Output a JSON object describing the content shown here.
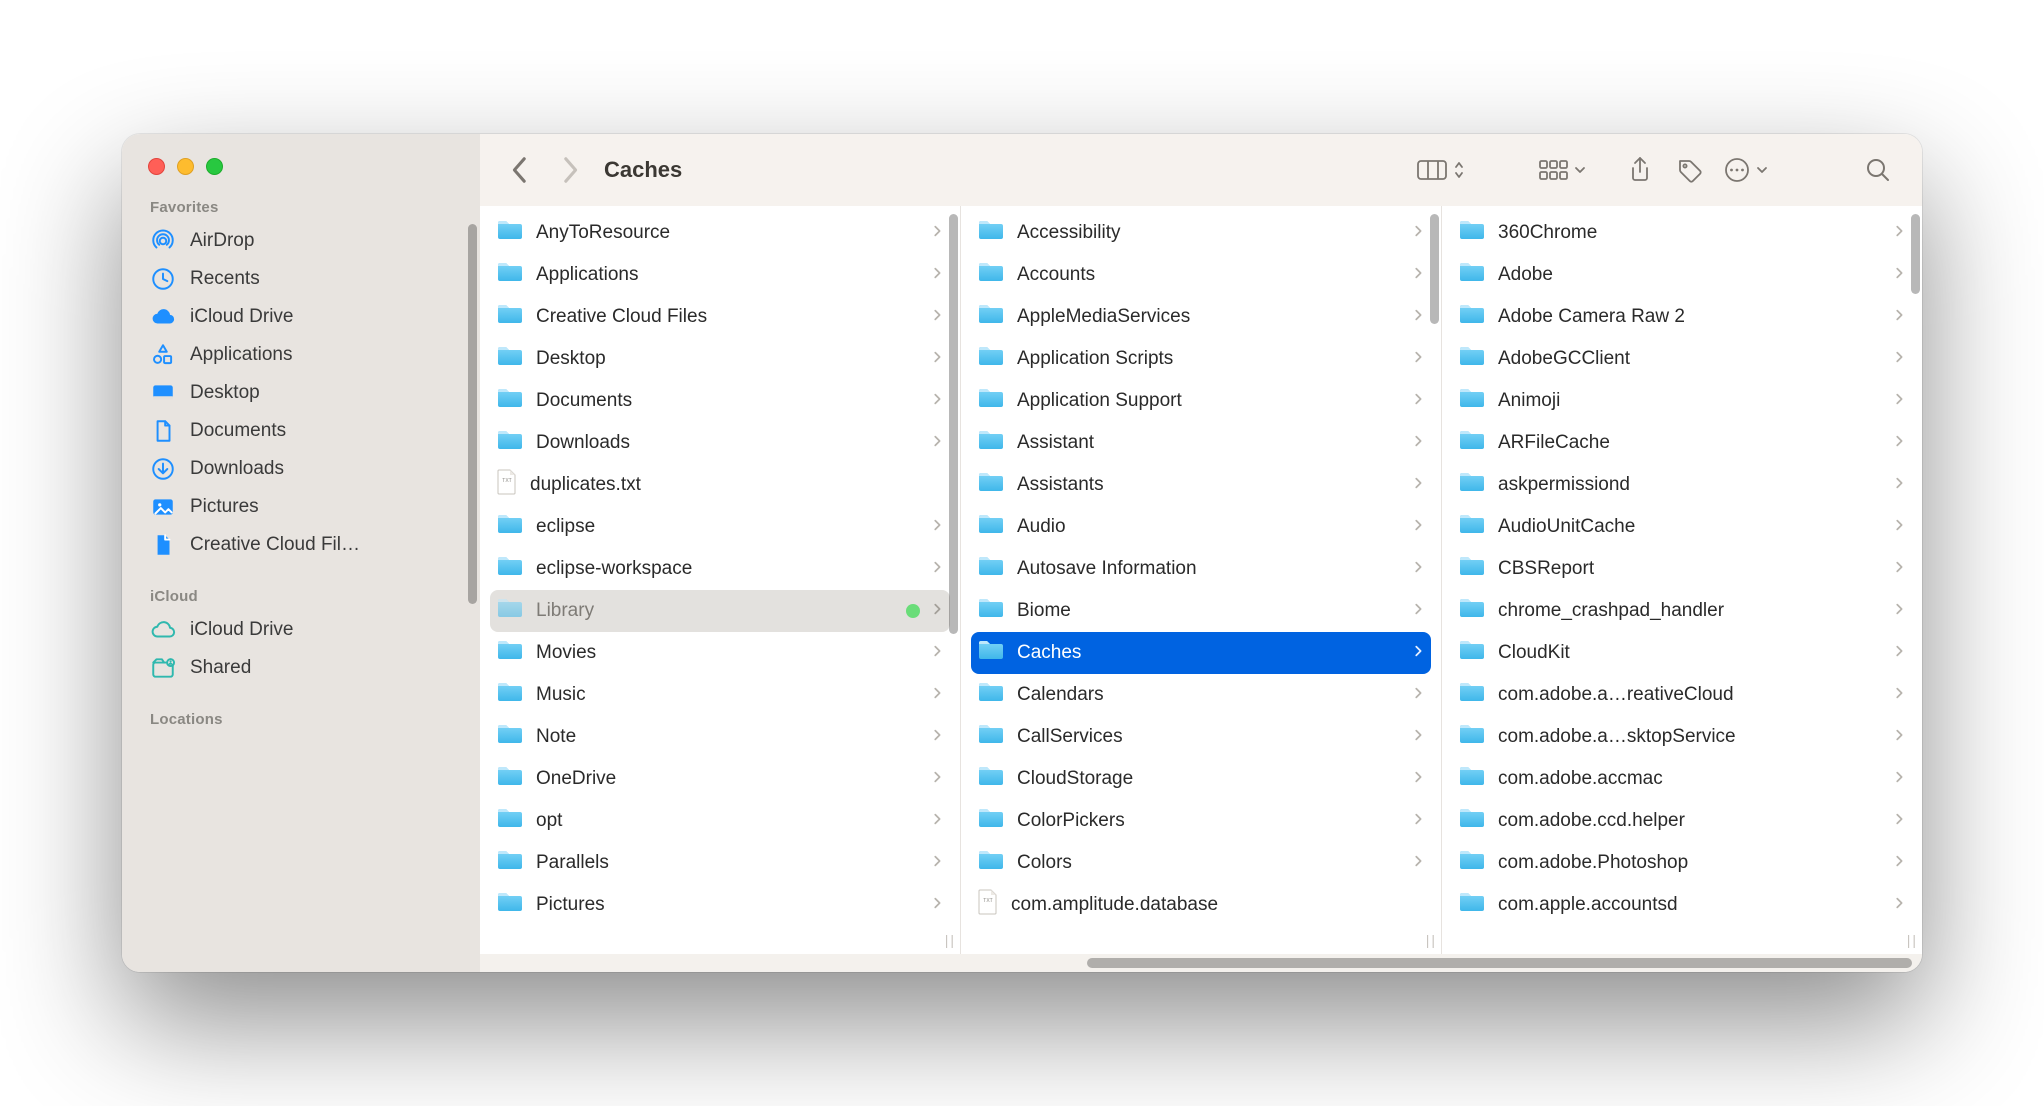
{
  "window_title": "Caches",
  "sidebar": {
    "sections": [
      {
        "heading": "Favorites",
        "items": [
          {
            "icon": "airdrop",
            "label": "AirDrop"
          },
          {
            "icon": "recents",
            "label": "Recents"
          },
          {
            "icon": "icloud",
            "label": "iCloud Drive"
          },
          {
            "icon": "apps",
            "label": "Applications"
          },
          {
            "icon": "desktop",
            "label": "Desktop"
          },
          {
            "icon": "doc",
            "label": "Documents"
          },
          {
            "icon": "downloads",
            "label": "Downloads"
          },
          {
            "icon": "pictures",
            "label": "Pictures"
          },
          {
            "icon": "ccfile",
            "label": "Creative Cloud Fil…"
          }
        ]
      },
      {
        "heading": "iCloud",
        "items": [
          {
            "icon": "icloud-outline",
            "label": "iCloud Drive"
          },
          {
            "icon": "shared",
            "label": "Shared"
          }
        ]
      },
      {
        "heading": "Locations",
        "items": []
      }
    ]
  },
  "columns": [
    {
      "scroll_thumb_height": 420,
      "items": [
        {
          "type": "folder",
          "name": "AnyToResource"
        },
        {
          "type": "folder",
          "name": "Applications"
        },
        {
          "type": "folder",
          "name": "Creative Cloud Files"
        },
        {
          "type": "folder",
          "name": "Desktop"
        },
        {
          "type": "folder",
          "name": "Documents"
        },
        {
          "type": "folder",
          "name": "Downloads"
        },
        {
          "type": "file",
          "name": "duplicates.txt"
        },
        {
          "type": "folder",
          "name": "eclipse"
        },
        {
          "type": "folder",
          "name": "eclipse-workspace"
        },
        {
          "type": "folder",
          "name": "Library",
          "selected": "bg",
          "tag": "#6add79"
        },
        {
          "type": "folder",
          "name": "Movies"
        },
        {
          "type": "folder",
          "name": "Music"
        },
        {
          "type": "folder",
          "name": "Note"
        },
        {
          "type": "folder",
          "name": "OneDrive"
        },
        {
          "type": "folder",
          "name": "opt"
        },
        {
          "type": "folder",
          "name": "Parallels"
        },
        {
          "type": "folder",
          "name": "Pictures"
        }
      ]
    },
    {
      "scroll_thumb_height": 110,
      "items": [
        {
          "type": "folder",
          "name": "Accessibility"
        },
        {
          "type": "folder",
          "name": "Accounts"
        },
        {
          "type": "folder",
          "name": "AppleMediaServices"
        },
        {
          "type": "folder",
          "name": "Application Scripts"
        },
        {
          "type": "folder",
          "name": "Application Support"
        },
        {
          "type": "folder",
          "name": "Assistant"
        },
        {
          "type": "folder",
          "name": "Assistants"
        },
        {
          "type": "folder",
          "name": "Audio"
        },
        {
          "type": "folder",
          "name": "Autosave Information"
        },
        {
          "type": "folder",
          "name": "Biome"
        },
        {
          "type": "folder",
          "name": "Caches",
          "selected": "hl"
        },
        {
          "type": "folder",
          "name": "Calendars"
        },
        {
          "type": "folder",
          "name": "CallServices"
        },
        {
          "type": "folder",
          "name": "CloudStorage"
        },
        {
          "type": "folder",
          "name": "ColorPickers"
        },
        {
          "type": "folder",
          "name": "Colors"
        },
        {
          "type": "file",
          "name": "com.amplitude.database",
          "no_chevron": true
        }
      ]
    },
    {
      "scroll_thumb_height": 80,
      "items": [
        {
          "type": "folder",
          "name": "360Chrome"
        },
        {
          "type": "folder",
          "name": "Adobe"
        },
        {
          "type": "folder",
          "name": "Adobe Camera Raw 2"
        },
        {
          "type": "folder",
          "name": "AdobeGCClient"
        },
        {
          "type": "folder",
          "name": "Animoji"
        },
        {
          "type": "folder",
          "name": "ARFileCache"
        },
        {
          "type": "folder",
          "name": "askpermissiond"
        },
        {
          "type": "folder",
          "name": "AudioUnitCache"
        },
        {
          "type": "folder",
          "name": "CBSReport"
        },
        {
          "type": "folder",
          "name": "chrome_crashpad_handler"
        },
        {
          "type": "folder",
          "name": "CloudKit"
        },
        {
          "type": "folder",
          "name": "com.adobe.a…reativeCloud"
        },
        {
          "type": "folder",
          "name": "com.adobe.a…sktopService"
        },
        {
          "type": "folder",
          "name": "com.adobe.accmac"
        },
        {
          "type": "folder",
          "name": "com.adobe.ccd.helper"
        },
        {
          "type": "folder",
          "name": "com.adobe.Photoshop"
        },
        {
          "type": "folder",
          "name": "com.apple.accountsd"
        }
      ]
    }
  ],
  "hscroll": {
    "thumb_width_pct": 58,
    "thumb_left_pct": 42
  }
}
